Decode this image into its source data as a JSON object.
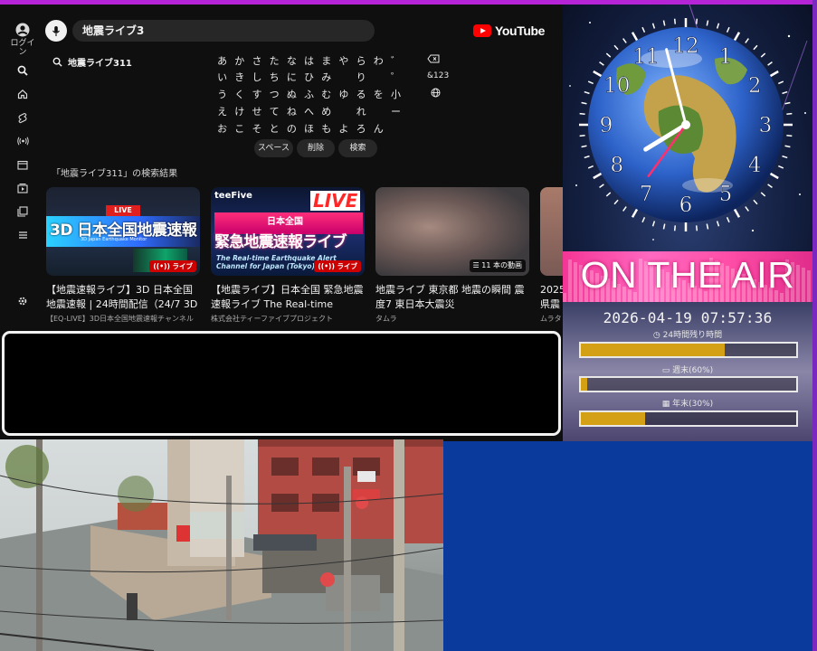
{
  "youtube": {
    "logo_text": "YouTube",
    "search_value": "地震ライブ3",
    "suggestion": "地震ライブ311",
    "login_label": "ログイン",
    "rail_icons": [
      "search-icon",
      "home-icon",
      "shorts-icon",
      "live-icon",
      "calendar-icon",
      "subscriptions-icon",
      "library-icon",
      "menu-icon",
      "settings-icon"
    ],
    "keyboard": {
      "rows": [
        [
          "あ",
          "か",
          "さ",
          "た",
          "な",
          "は",
          "ま",
          "や",
          "ら",
          "わ",
          "゛"
        ],
        [
          "い",
          "き",
          "し",
          "ち",
          "に",
          "ひ",
          "み",
          "",
          "り",
          "",
          "゜"
        ],
        [
          "う",
          "く",
          "す",
          "つ",
          "ぬ",
          "ふ",
          "む",
          "ゆ",
          "る",
          "を",
          "小"
        ],
        [
          "え",
          "け",
          "せ",
          "て",
          "ね",
          "へ",
          "め",
          "",
          "れ",
          "",
          "ー"
        ],
        [
          "お",
          "こ",
          "そ",
          "と",
          "の",
          "ほ",
          "も",
          "よ",
          "ろ",
          "ん",
          ""
        ]
      ],
      "mode_label": "&123",
      "space_label": "スペース",
      "delete_label": "削除",
      "search_label": "検索"
    },
    "results_title": "「地震ライブ311」の検索結果",
    "results": [
      {
        "title": "【地震速報ライブ】3D 日本全国地震速報 | 24時間配信（24/7 3D",
        "channel": "【EQ-LIVE】3D日本全国地震速報チャンネル",
        "badge": "ライブ",
        "thumb_live": "LIVE",
        "thumb_headline": "3D 日本全国地震速報",
        "thumb_sub": "3D Japan Earthquake Monitor"
      },
      {
        "title": "【地震ライブ】日本全国 緊急地震速報ライブ The Real-time",
        "channel": "株式会社ティーファイブプロジェクト",
        "badge": "ライブ",
        "thumb_brand": "teeFive",
        "thumb_live": "LIVE",
        "thumb_headline_a": "日本全国",
        "thumb_headline_b": "緊急地震速報ライブ",
        "thumb_sub": "The Real-time Earthquake Alert Channel for Japan (Tokyo)"
      },
      {
        "title": "地震ライブ 東京都 地震の瞬間 震度7 東日本大震災",
        "channel": "タムラ",
        "playlist_count": "11 本の動画"
      },
      {
        "title": "2025 県震",
        "channel": "ムラタ"
      }
    ]
  },
  "clock_panel": {
    "clock_numbers": [
      "12",
      "1",
      "2",
      "3",
      "4",
      "5",
      "6",
      "7",
      "8",
      "9",
      "10",
      "11"
    ],
    "clock_time": {
      "hour": 7,
      "minute": 57,
      "second": 36
    },
    "on_air_text": "ON THE AIR",
    "datetime": "2026-04-19 07:57:36",
    "bars": [
      {
        "label": "24時間残り時間",
        "fill": 0.67
      },
      {
        "label": "週末(60%)",
        "fill": 0.03
      },
      {
        "label": "年末(30%)",
        "fill": 0.3
      }
    ]
  },
  "colors": {
    "top_strip": "#b524d6",
    "blue_panel": "#0a3a9c",
    "on_air_band": "#f43596",
    "progress_fill": "#d4a015"
  }
}
